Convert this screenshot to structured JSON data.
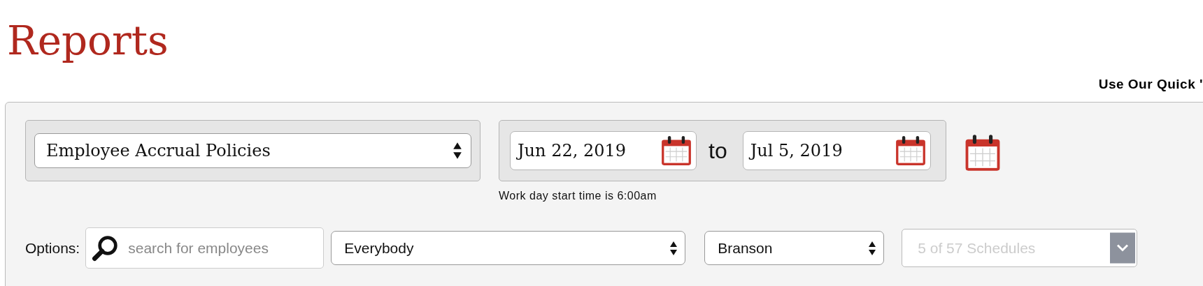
{
  "page_title": "Reports",
  "quick_link": "Use Our Quick '",
  "report_select": {
    "value": "Employee Accrual Policies"
  },
  "date_range": {
    "start": "Jun 22, 2019",
    "separator": "to",
    "end": "Jul 5, 2019"
  },
  "work_day_note": "Work day start time is 6:00am",
  "options": {
    "label": "Options:",
    "search": {
      "placeholder": "search for employees"
    },
    "employee_filter": {
      "value": "Everybody"
    },
    "location": {
      "value": "Branson"
    },
    "schedules": {
      "placeholder": "5 of 57 Schedules",
      "disabled": true
    }
  }
}
